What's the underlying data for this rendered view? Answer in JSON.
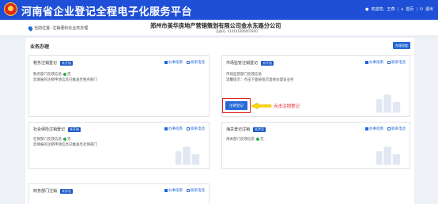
{
  "header": {
    "title": "河南省企业登记全程电子化服务平台",
    "nav": {
      "user": "欢迎您，王燕",
      "home": "首页",
      "logout": "退出"
    }
  },
  "infobar": {
    "location": "当前位置: 注销便利化业务办理",
    "company": "郑州市美华房地产营销策划有限公司金水东路分公司",
    "credit_code": "注册号: 410101000007840"
  },
  "main": {
    "section_title": "业务办理",
    "progress_button": "办理进度"
  },
  "cards": [
    {
      "title": "税务注销登记",
      "badge": "未开始",
      "guide": "办事指南",
      "phone": "联系电话",
      "line1_label": "税务部门反馈信息",
      "line1_value": "无",
      "line2": "您填报的注销申请信息已推送至税务部门"
    },
    {
      "title": "市场监管注销登记",
      "badge": "未开始",
      "guide": "办事指南",
      "phone": "联系电话",
      "line1_label": "市场监管部门反馈信息",
      "line2": "温馨提示：点击下面按钮可直接办理该业务",
      "button": "注销登记"
    },
    {
      "title": "社会保险注销登记",
      "badge": "未开始",
      "guide": "办事指南",
      "phone": "联系电话",
      "line1_label": "社保部门反馈信息",
      "line1_value": "无",
      "line2": "您填报的注销申请信息已推送至社保部门"
    },
    {
      "title": "海关登记注销",
      "badge": "未涉及",
      "guide": "办事指南",
      "phone": "联系电话",
      "line1_label": "海关部门反馈信息",
      "line1_value": "无"
    },
    {
      "title": "商务部门注销",
      "badge": "未涉及",
      "guide": "办事指南",
      "phone": "联系电话"
    }
  ],
  "annotation": "点击注销登记",
  "colors": {
    "header": "#1f4fd6",
    "accent": "#2469d6",
    "annotation": "#e02020"
  }
}
